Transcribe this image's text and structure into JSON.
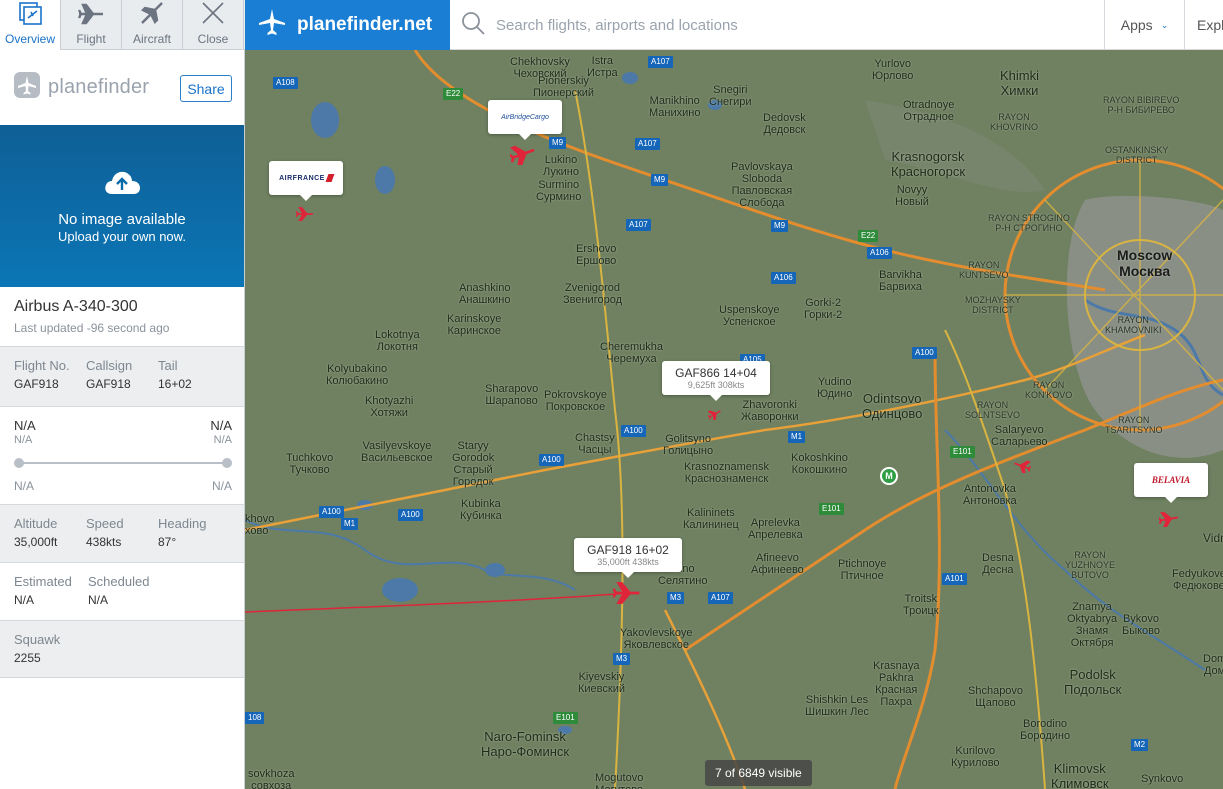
{
  "tabs": [
    {
      "label": "Overview",
      "icon": "overview-icon",
      "active": true
    },
    {
      "label": "Flight",
      "icon": "plane-icon"
    },
    {
      "label": "Aircraft",
      "icon": "aircraft-icon"
    },
    {
      "label": "Close",
      "icon": "close-icon"
    }
  ],
  "panel": {
    "brand": "planefinder",
    "share_label": "Share",
    "photo_title": "No image available",
    "photo_sub": "Upload your own now.",
    "aircraft_type": "Airbus A-340-300",
    "last_updated": "Last updated -96 second ago",
    "flight": {
      "flight_no_label": "Flight No.",
      "flight_no": "GAF918",
      "callsign_label": "Callsign",
      "callsign": "GAF918",
      "tail_label": "Tail",
      "tail": "16+02"
    },
    "route": {
      "origin": "N/A",
      "origin_sub": "N/A",
      "origin_foot": "N/A",
      "dest": "N/A",
      "dest_sub": "N/A",
      "dest_foot": "N/A"
    },
    "perf": {
      "altitude_label": "Altitude",
      "altitude": "35,000ft",
      "speed_label": "Speed",
      "speed": "438kts",
      "heading_label": "Heading",
      "heading": "87°"
    },
    "times": {
      "estimated_label": "Estimated",
      "estimated": "N/A",
      "scheduled_label": "Scheduled",
      "scheduled": "N/A"
    },
    "squawk": {
      "label": "Squawk",
      "value": "2255"
    }
  },
  "header": {
    "logo": "planefinder.net",
    "search_placeholder": "Search flights, airports and locations",
    "apps_label": "Apps",
    "explore_label": "Expl"
  },
  "map": {
    "visible_count": "7 of 6849 visible",
    "callouts": {
      "gaf866_title": "GAF866 14+04",
      "gaf866_sub": "9,625ft 308kts",
      "gaf918_title": "GAF918 16+02",
      "gaf918_sub": "35,000ft 438kts"
    },
    "airline_logos": {
      "air_france": "AIRFRANCE",
      "airbridge": "AirBridgeCargo",
      "belavia": "BELAVIA"
    },
    "places": {
      "chekhovsky": "Chekhovsky\nЧеховский",
      "pionerskiy": "Pionerskiy\nПионерский",
      "istra": "Istra\nИстра",
      "snegiri": "Snegiri\nСнегири",
      "manikhino": "Manikhino\nМанихино",
      "yurlovo": "Yurlovo\nЮрлово",
      "khimki": "Khimki\nХимки",
      "dedovsk": "Dedovsk\nДедовск",
      "otradnoye": "Otradnoye\nОтрадное",
      "lukino": "Lukino\nЛукино",
      "surmino": "Surmino\nСурмино",
      "pavlovskaya": "Pavlovskaya\nSloboda\nПавловская\nСлобода",
      "krasnogorsk": "Krasnogorsk\nКрасногорск",
      "novyy": "Novyy\nНовый",
      "ershovo": "Ershovo\nЕршово",
      "zvenigorod": "Zvenigorod\nЗвенигород",
      "anashkino": "Anashkino\nАнашкино",
      "karinskoye": "Karinskoye\nКаринское",
      "barvikha": "Barvikha\nБарвиха",
      "uspenskoye": "Uspenskoye\nУспенское",
      "gorki2": "Gorki-2\nГорки-2",
      "moscow": "Moscow\nМосква",
      "lokotnya": "Lokotnya\nЛокотня",
      "kolyubakino": "Kolyubakino\nКолюбакино",
      "cheremukha": "Cheremukha\nЧеремуха",
      "odintsovo": "Odintsovo\nОдинцово",
      "yudino": "Yudino\nЮдино",
      "zhavoronki": "Zhavoronki\nЖаворонки",
      "sharapovo": "Sharapovo\nШарапово",
      "pokrovskoye": "Pokrovskoye\nПокровское",
      "khotyazhi": "Khotyazhi\nХотяжи",
      "golitsyno": "Golitsyno\nГолицыно",
      "chastsy": "Chastsy\nЧасцы",
      "vasilyevskoye": "Vasilyevskoye\nВасильевское",
      "staryy_gorodok": "Staryy\nGorodok\nСтарый\nГородок",
      "tuchkovo": "Tuchkovo\nТучково",
      "krasnoznamensk": "Krasnoznamensk\nКраснознаменск",
      "kokoshkino": "Kokoshkino\nКокошкино",
      "salaryevo": "Salaryevo\nСаларьево",
      "antonovka": "Antonovka\nАнтоновка",
      "kubinka": "Kubinka\nКубинка",
      "kalininets": "Kalininets\nКалининец",
      "aprelevka": "Aprelevka\nАпрелевка",
      "vidnoye": "Vidno",
      "khovo": "khovo\nхово",
      "selyatino": "atino\nСелятино",
      "afineevo": "Afineevo\nАфинеево",
      "ptichnoye": "Ptichnoye\nПтичное",
      "desna": "Desna\nДесна",
      "fedyukovo": "Fedyukove\nФедюкове",
      "troitsk": "Troitsk\nТроицк",
      "znamya": "Znamya\nOktyabrya\nЗнамя\nОктября",
      "bykovo": "Bykovo\nБыково",
      "yakovlevskoye": "Yakovlevskoye\nЯковлевское",
      "podolsk": "Podolsk\nПодольск",
      "krasnaya_pakhra": "Krasnaya\nPakhra\nКрасная\nПахра",
      "kiyevskiy": "Kiyevskiy\nКиевский",
      "shishkin_les": "Shishkin Les\nШишкин Лес",
      "shchapovo": "Shchapovo\nЩапово",
      "dom": "Dom\nДом",
      "naro_fominsk": "Naro-Fominsk\nНаро-Фоминск",
      "borodino": "Borodino\nБородино",
      "kurilovo": "Kurilovo\nКурилово",
      "klimovsk": "Klimovsk\nКлимовск",
      "sovkhoza": "sovkhoza\nсовхоза",
      "mogutovo": "Mogutovo\nМогутово",
      "synkovo": "Synkovo"
    }
  }
}
